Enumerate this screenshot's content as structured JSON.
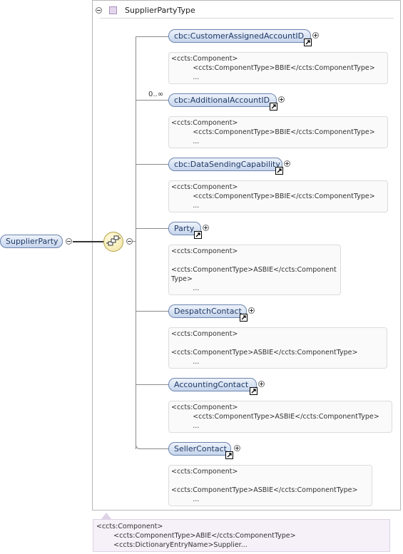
{
  "complex_type": {
    "name": "SupplierPartyType",
    "icons": [
      "collapse-icon",
      "complex-type-icon"
    ]
  },
  "root_element": {
    "name": "SupplierParty",
    "icons": [
      "collapse-icon"
    ]
  },
  "compositor": {
    "kind": "sequence",
    "icon": "sequence-compositor-icon"
  },
  "children": [
    {
      "name": "cbc:CustomerAssignedAccountID",
      "occurrence": "",
      "doc": "<ccts:Component>\n          <ccts:ComponentType>BBIE</ccts:ComponentType>\n          ..."
    },
    {
      "name": "cbc:AdditionalAccountID",
      "occurrence": "0..∞",
      "doc": "<ccts:Component>\n          <ccts:ComponentType>BBIE</ccts:ComponentType>\n          ..."
    },
    {
      "name": "cbc:DataSendingCapability",
      "occurrence": "",
      "doc": "<ccts:Component>\n          <ccts:ComponentType>BBIE</ccts:ComponentType>\n          ..."
    },
    {
      "name": "Party",
      "occurrence": "",
      "doc": "<ccts:Component>\n\n<ccts:ComponentType>ASBIE</ccts:Component\nType>\n          ..."
    },
    {
      "name": "DespatchContact",
      "occurrence": "",
      "doc": "<ccts:Component>\n\n<ccts:ComponentType>ASBIE</ccts:ComponentType>\n          ..."
    },
    {
      "name": "AccountingContact",
      "occurrence": "",
      "doc": "<ccts:Component>\n          <ccts:ComponentType>ASBIE</ccts:ComponentType>\n          ..."
    },
    {
      "name": "SellerContact",
      "occurrence": "",
      "doc": "<ccts:Component>\n\n<ccts:ComponentType>ASBIE</ccts:ComponentType>\n          ..."
    }
  ],
  "type_doc": "<ccts:Component>\n        <ccts:ComponentType>ABIE</ccts:ComponentType>\n        <ccts:DictionaryEntryName>Supplier..."
}
